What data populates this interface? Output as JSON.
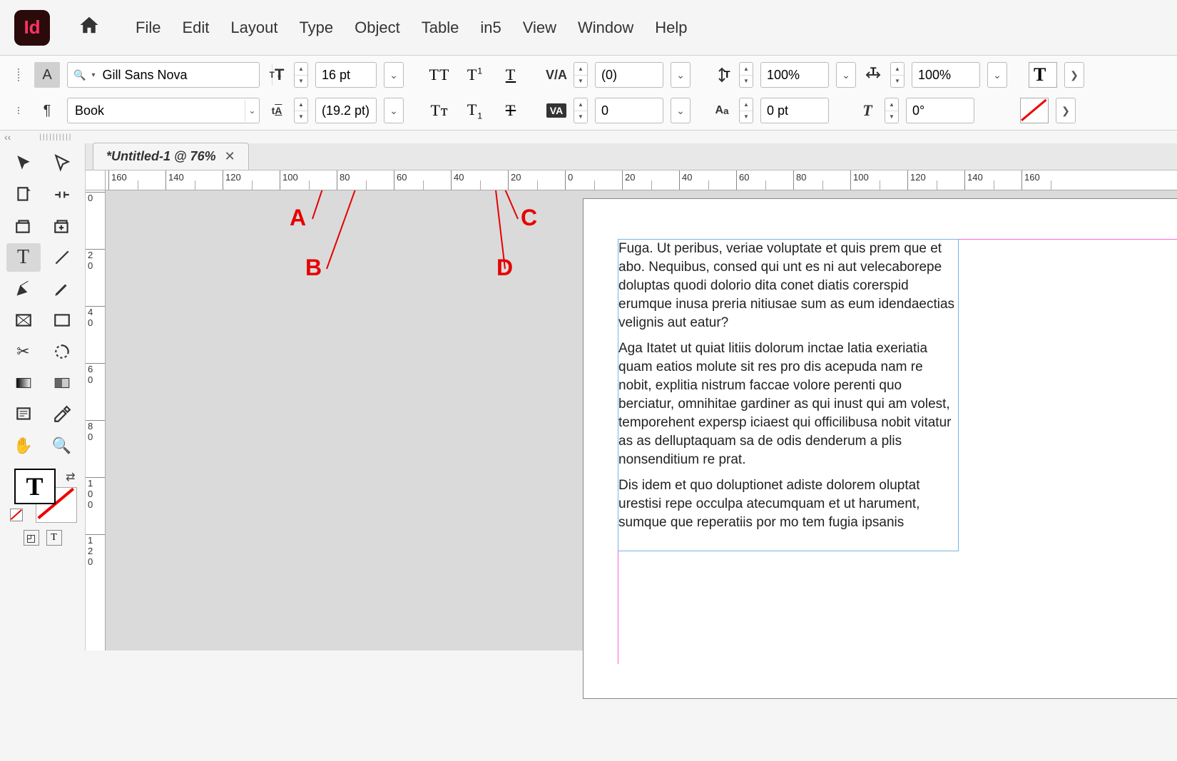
{
  "menu": {
    "items": [
      "File",
      "Edit",
      "Layout",
      "Type",
      "Object",
      "Table",
      "in5",
      "View",
      "Window",
      "Help"
    ]
  },
  "control": {
    "font_family": "Gill Sans Nova",
    "font_style": "Book",
    "font_size": "16 pt",
    "leading": "(19.2 pt)",
    "kerning": "(0)",
    "tracking": "0",
    "vscale": "100%",
    "hscale": "100%",
    "baseline": "0 pt",
    "skew": "0°"
  },
  "document": {
    "tab_title": "*Untitled-1 @ 76%"
  },
  "ruler_h": [
    "160",
    "140",
    "120",
    "100",
    "80",
    "60",
    "40",
    "20",
    "0",
    "20",
    "40",
    "60",
    "80",
    "100",
    "120",
    "140",
    "160"
  ],
  "ruler_v": [
    "0",
    "20",
    "40",
    "60",
    "80",
    "100",
    "120"
  ],
  "annotations": {
    "a": "A",
    "b": "B",
    "c": "C",
    "d": "D"
  },
  "bodytext": {
    "p1": "Fuga. Ut peribus, veriae voluptate et quis prem que et abo. Nequibus, consed qui unt es ni aut velecaborepe doluptas quodi dolorio dita conet diatis corerspid erumque inusa preria nitiusae sum as eum idendaectias velignis aut eatur?",
    "p2": "Aga Itatet ut quiat litiis dolorum inctae latia exeriatia quam eatios molute sit res pro dis acepuda nam re nobit, explitia nistrum faccae volore perenti quo berciatur, omnihitae gardiner as qui inust qui am volest, temporehent expersp iciaest qui officilibusa nobit vitatur as as delluptaquam sa de odis denderum a plis nonsenditium re prat.",
    "p3": "Dis idem et quo doluptionet adiste dolorem oluptat urestisi repe occulpa atecumquam et ut harument, sumque que reperatiis por mo tem fugia ipsanis"
  }
}
